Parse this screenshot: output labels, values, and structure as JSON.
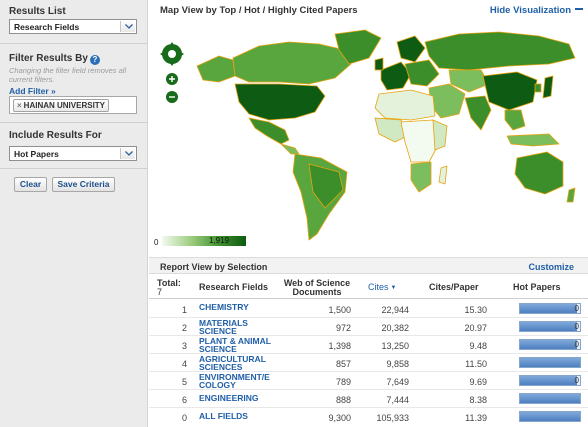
{
  "sidebar": {
    "results_list_title": "Results List",
    "results_list_value": "Research Fields",
    "filter_title": "Filter Results By",
    "filter_note": "Changing the filter field removes all current filters.",
    "add_filter": "Add Filter »",
    "filter_chip": "HAINAN UNIVERSITY",
    "filter_chip_remove": "×",
    "include_title": "Include Results For",
    "include_value": "Hot Papers",
    "clear_label": "Clear",
    "save_label": "Save Criteria"
  },
  "map": {
    "title": "Map View by Top / Hot / Highly Cited Papers",
    "hide_label": "Hide Visualization",
    "legend_min": "0",
    "legend_max": "1,919"
  },
  "report": {
    "title": "Report View by Selection",
    "customize_label": "Customize"
  },
  "table": {
    "headers": {
      "total": "Total:",
      "total_value": "7",
      "field": "Research Fields",
      "docs_line1": "Web of Science",
      "docs_line2": "Documents",
      "cites": "Cites",
      "cites_paper": "Cites/Paper",
      "hot": "Hot Papers"
    },
    "rows": [
      {
        "rank": "1",
        "field_l1": "CHEMISTRY",
        "field_l2": "",
        "docs": "1,500",
        "cites": "22,944",
        "cpp": "15.30",
        "hot": "0",
        "hot_fraction": 0.95
      },
      {
        "rank": "2",
        "field_l1": "MATERIALS",
        "field_l2": "SCIENCE",
        "docs": "972",
        "cites": "20,382",
        "cpp": "20.97",
        "hot": "0",
        "hot_fraction": 0.95
      },
      {
        "rank": "3",
        "field_l1": "PLANT & ANIMAL",
        "field_l2": "SCIENCE",
        "docs": "1,398",
        "cites": "13,250",
        "cpp": "9.48",
        "hot": "0",
        "hot_fraction": 0.95
      },
      {
        "rank": "4",
        "field_l1": "AGRICULTURAL",
        "field_l2": "SCIENCES",
        "docs": "857",
        "cites": "9,858",
        "cpp": "11.50",
        "hot": "",
        "hot_fraction": 1.0
      },
      {
        "rank": "5",
        "field_l1": "ENVIRONMENT/E",
        "field_l2": "COLOGY",
        "docs": "789",
        "cites": "7,649",
        "cpp": "9.69",
        "hot": "0",
        "hot_fraction": 0.95
      },
      {
        "rank": "6",
        "field_l1": "ENGINEERING",
        "field_l2": "",
        "docs": "888",
        "cites": "7,444",
        "cpp": "8.38",
        "hot": "",
        "hot_fraction": 1.0
      },
      {
        "rank": "0",
        "field_l1": "ALL FIELDS",
        "field_l2": "",
        "docs": "9,300",
        "cites": "105,933",
        "cpp": "11.39",
        "hot": "",
        "hot_fraction": 1.0
      }
    ]
  },
  "colors": {
    "accent": "#1f5fa8",
    "map_dark": "#0e5b14",
    "map_mid": "#3b8e2a",
    "map_light": "#9ccc7e",
    "map_pale": "#f3faf0",
    "map_border": "#e6a30e"
  },
  "icons": [
    "chevron-down-icon",
    "help-icon",
    "close-icon",
    "pan-control-icon",
    "zoom-in-icon",
    "zoom-out-icon",
    "sort-desc-icon",
    "collapse-icon"
  ]
}
